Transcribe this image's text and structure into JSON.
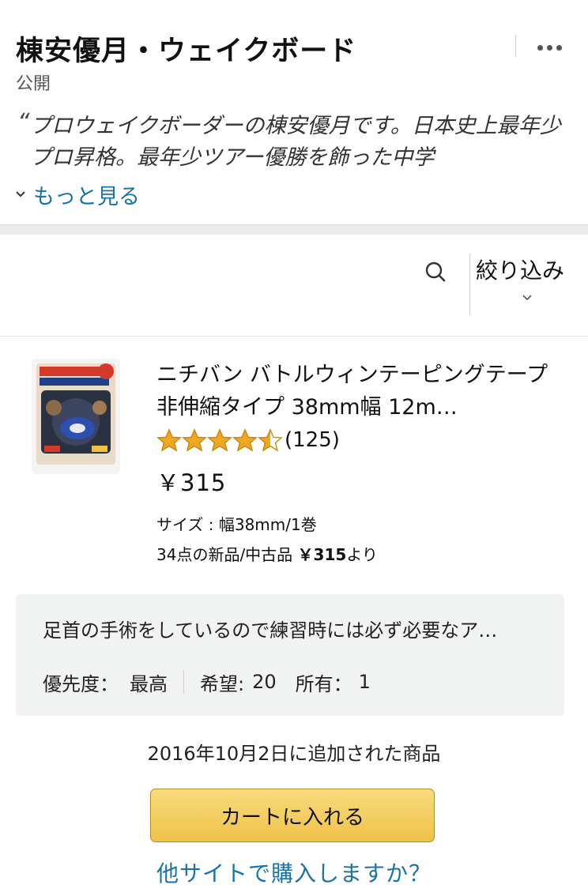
{
  "header": {
    "title": "棟安優月・ウェイクボード",
    "visibility": "公開",
    "more_menu_icon": "more-horizontal-icon",
    "quote_mark": "“",
    "description": "プロウェイクボーダーの棟安優月です。日本史上最年少プロ昇格。最年少ツアー優勝を飾った中学",
    "see_more_label": "もっと見る"
  },
  "toolbar": {
    "search_icon": "search-icon",
    "filter_label": "絞り込み",
    "filter_icon": "chevron-down-icon"
  },
  "item": {
    "title": "ニチバン バトルウィンテーピングテープ 非伸縮タイプ 38mm幅 12m…",
    "rating": 4.5,
    "rating_max": 5,
    "review_count": "(125)",
    "price": "￥315",
    "variant": "サイズ : 幅38mm/1巻",
    "offers_prefix": "34点の新品/中古品 ",
    "offers_price": "￥315",
    "offers_suffix": "より",
    "comment": "足首の手術をしているので練習時には必ず必要なア…",
    "priority_label": "優先度：",
    "priority_value": "最高",
    "wanted_label": "希望:",
    "wanted_value": "20",
    "owned_label": "所有：",
    "owned_value": "1",
    "added_date": "2016年10月2日に追加された商品",
    "cart_button": "カートに入れる",
    "other_sites_link": "他サイトで購入しますか？"
  },
  "colors": {
    "link": "#1a73a8",
    "star": "#f0a820",
    "cart_button": "#f0c14b",
    "band": "#e9eaea"
  }
}
